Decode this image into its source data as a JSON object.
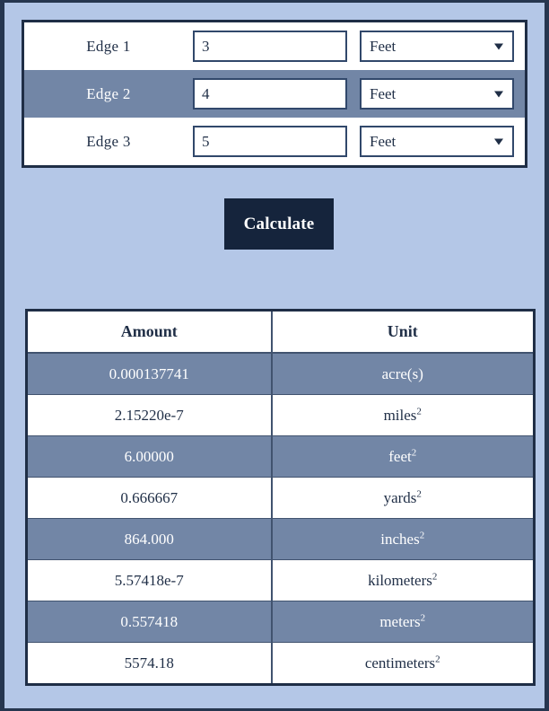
{
  "colors": {
    "page_background": "#b4c7e7",
    "frame_border": "#26364f",
    "panel_border": "#1f2e46",
    "alt_row": "#7286a6",
    "button_background": "#15243c",
    "button_text": "#ffffff",
    "text": "#1f2e46"
  },
  "input_panel": {
    "rows": [
      {
        "label": "Edge 1",
        "value": "3",
        "placeholder": "",
        "unit": "Feet",
        "caret_icon": "chevron-down-icon"
      },
      {
        "label": "Edge 2",
        "value": "4",
        "placeholder": "",
        "unit": "Feet",
        "caret_icon": "chevron-down-icon"
      },
      {
        "label": "Edge 3",
        "value": "5",
        "placeholder": "",
        "unit": "Feet",
        "caret_icon": "chevron-down-icon"
      }
    ]
  },
  "actions": {
    "calculate_label": "Calculate"
  },
  "results": {
    "headers": [
      "Amount",
      "Unit"
    ],
    "rows": [
      {
        "amount": "0.000137741",
        "unit": "acre(s)",
        "exponent": ""
      },
      {
        "amount": "2.15220e-7",
        "unit": "miles",
        "exponent": "2"
      },
      {
        "amount": "6.00000",
        "unit": "feet",
        "exponent": "2"
      },
      {
        "amount": "0.666667",
        "unit": "yards",
        "exponent": "2"
      },
      {
        "amount": "864.000",
        "unit": "inches",
        "exponent": "2"
      },
      {
        "amount": "5.57418e-7",
        "unit": "kilometers",
        "exponent": "2"
      },
      {
        "amount": "0.557418",
        "unit": "meters",
        "exponent": "2"
      },
      {
        "amount": "5574.18",
        "unit": "centimeters",
        "exponent": "2"
      }
    ]
  }
}
